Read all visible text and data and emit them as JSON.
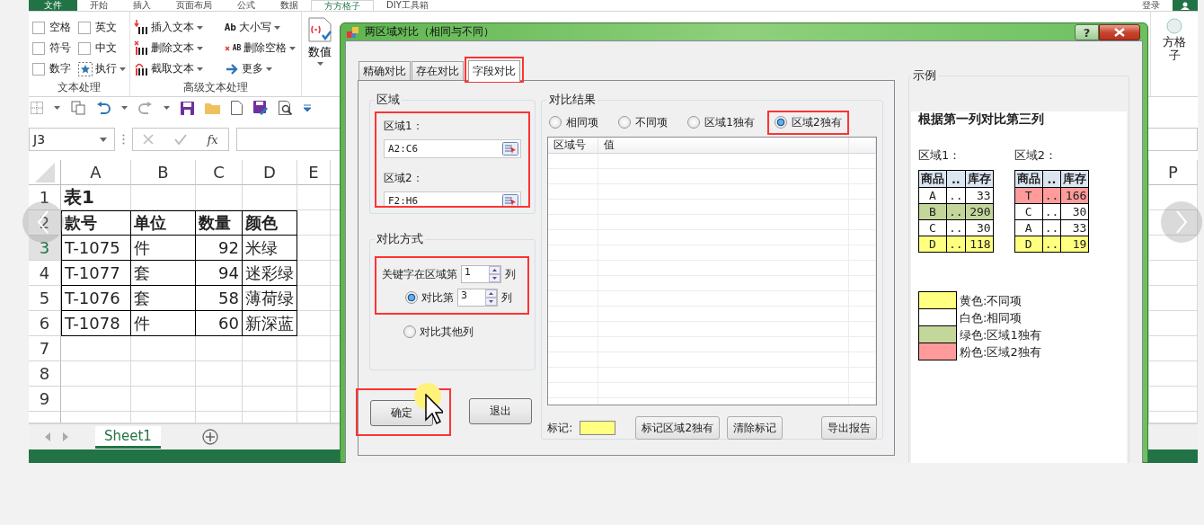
{
  "excel": {
    "file_tab": "文件",
    "tabs": [
      {
        "label": "开始",
        "selected": false
      },
      {
        "label": "插入",
        "selected": false
      },
      {
        "label": "页面布局",
        "selected": false
      },
      {
        "label": "公式",
        "selected": false
      },
      {
        "label": "数据",
        "selected": false
      },
      {
        "label": "方方格子",
        "selected": true
      },
      {
        "label": "DIY工具箱",
        "selected": false
      }
    ],
    "sign_in": "登录",
    "text_group": {
      "label": "文本处理",
      "checkboxes": [
        {
          "label": "空格",
          "checked": false
        },
        {
          "label": "英文",
          "checked": false
        },
        {
          "label": "符号",
          "checked": false
        },
        {
          "label": "中文",
          "checked": false
        },
        {
          "label": "数字",
          "checked": false
        }
      ],
      "run": "执行"
    },
    "advanced_group": {
      "label": "高级文本处理",
      "tools": [
        {
          "kind": "insert",
          "label": "插入文本"
        },
        {
          "kind": "delete",
          "label": "删除文本"
        },
        {
          "kind": "extract",
          "label": "截取文本"
        },
        {
          "kind": "case",
          "icon_text": "Ab",
          "label": "大小写"
        },
        {
          "kind": "trim",
          "icon_text": "AB",
          "label": "删除空格"
        },
        {
          "kind": "more",
          "label": "更多"
        }
      ]
    },
    "number_button": "数值",
    "side_button_lines": [
      "方格",
      "子"
    ],
    "name_box": "J3",
    "fx": "fx",
    "columns": [
      "A",
      "B",
      "C",
      "D",
      "E"
    ],
    "far_column": "P",
    "rows": [
      {
        "number": "1",
        "kind": "title",
        "selected": false,
        "cells": [
          "表1"
        ]
      },
      {
        "number": "2",
        "kind": "header",
        "selected": false,
        "cells": [
          "款号",
          "单位",
          "数量",
          "颜色"
        ]
      },
      {
        "number": "3",
        "kind": "data",
        "selected": true,
        "cells": [
          "T-1075",
          "件",
          "92",
          "米绿"
        ]
      },
      {
        "number": "4",
        "kind": "data",
        "selected": false,
        "cells": [
          "T-1077",
          "套",
          "94",
          "迷彩绿"
        ]
      },
      {
        "number": "5",
        "kind": "data",
        "selected": false,
        "cells": [
          "T-1076",
          "套",
          "58",
          "薄荷绿"
        ]
      },
      {
        "number": "6",
        "kind": "data",
        "selected": false,
        "cells": [
          "T-1078",
          "件",
          "60",
          "新深蓝"
        ]
      },
      {
        "number": "7",
        "kind": "empty",
        "selected": false
      },
      {
        "number": "8",
        "kind": "empty",
        "selected": false
      },
      {
        "number": "9",
        "kind": "empty",
        "selected": false
      }
    ],
    "sheets": [
      {
        "label": "Sheet1",
        "selected": true
      }
    ]
  },
  "dialog": {
    "title": "两区域对比（相同与不同）",
    "help_button": "?",
    "tabs": [
      {
        "label": "精确对比",
        "selected": false
      },
      {
        "label": "存在对比",
        "selected": false
      },
      {
        "label": "字段对比",
        "selected": true,
        "highlight": true
      }
    ],
    "range_group": {
      "title": "区域",
      "highlight": true,
      "ranges": [
        {
          "label": "区域1：",
          "value": "A2:C6"
        },
        {
          "label": "区域2：",
          "value": "F2:H6"
        }
      ]
    },
    "method_group": {
      "title": "对比方式",
      "highlight": true,
      "key_label": "关键字在区域第",
      "key_value": "1",
      "key_unit": "列",
      "options": [
        {
          "kind": "column",
          "label": "对比第",
          "selected": true,
          "value": "3",
          "unit": "列"
        },
        {
          "kind": "plain",
          "label": "对比其他列",
          "selected": false
        }
      ]
    },
    "buttons": [
      {
        "label": "确定",
        "highlight": true
      },
      {
        "label": "退出",
        "highlight": false
      }
    ],
    "result_group": {
      "title": "对比结果",
      "filters": [
        {
          "label": "相同项",
          "selected": false
        },
        {
          "label": "不同项",
          "selected": false
        },
        {
          "label": "区域1独有",
          "selected": false
        },
        {
          "label": "区域2独有",
          "selected": true,
          "highlight": true
        }
      ],
      "columns": [
        "区域号",
        "值"
      ],
      "mark": {
        "label": "标记:",
        "color": "#ffff80"
      },
      "actions": [
        "标记区域2独有",
        "清除标记",
        "导出报告"
      ]
    },
    "example": {
      "title": "示例",
      "heading": "根据第一列对比第三列",
      "tables": [
        {
          "label": "区域1：",
          "columns": [
            "商品",
            "..",
            "库存"
          ],
          "rows": [
            {
              "cells": [
                "A",
                "..",
                "33"
              ],
              "color": "#ffffff"
            },
            {
              "cells": [
                "B",
                "..",
                "290"
              ],
              "color": "#c4d79b"
            },
            {
              "cells": [
                "C",
                "..",
                "30"
              ],
              "color": "#ffffff"
            },
            {
              "cells": [
                "D",
                "..",
                "118"
              ],
              "color": "#ffff80"
            }
          ]
        },
        {
          "label": "区域2：",
          "columns": [
            "商品",
            "..",
            "库存"
          ],
          "rows": [
            {
              "cells": [
                "T",
                "..",
                "166"
              ],
              "color": "#ff9b9b"
            },
            {
              "cells": [
                "C",
                "..",
                "30"
              ],
              "color": "#ffffff"
            },
            {
              "cells": [
                "A",
                "..",
                "33"
              ],
              "color": "#ffffff"
            },
            {
              "cells": [
                "D",
                "..",
                "19"
              ],
              "color": "#ffff80"
            }
          ]
        }
      ],
      "legend": [
        {
          "color": "#ffff80",
          "text": "黄色:不同项"
        },
        {
          "color": "#ffffff",
          "text": "白色:相同项"
        },
        {
          "color": "#c4d79b",
          "text": "绿色:区域1独有"
        },
        {
          "color": "#ff9b9b",
          "text": "粉色:区域2独有"
        }
      ]
    }
  }
}
